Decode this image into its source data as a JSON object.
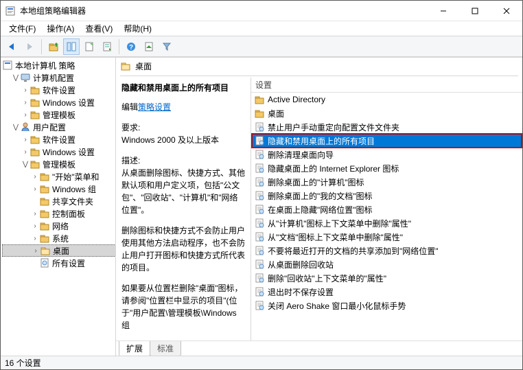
{
  "title": "本地组策略编辑器",
  "menus": {
    "file": "文件(F)",
    "action": "操作(A)",
    "view": "查看(V)",
    "help": "帮助(H)"
  },
  "toolbar": {
    "back": "后退",
    "forward": "前进",
    "up": "上一级",
    "properties": "属性",
    "refresh": "刷新",
    "export": "导出列表",
    "help": "帮助",
    "show": "显示/隐藏",
    "filter": "筛选"
  },
  "tree": {
    "root": "本地计算机 策略",
    "computer": "计算机配置",
    "user": "用户配置",
    "software": "软件设置",
    "windows": "Windows 设置",
    "admin": "管理模板",
    "start_menu": "\"开始\"菜单和",
    "windows_components": "Windows 组",
    "shared_folders": "共享文件夹",
    "control_panel": "控制面板",
    "network": "网络",
    "system": "系统",
    "desktop": "桌面",
    "all_settings": "所有设置"
  },
  "right": {
    "header": "桌面",
    "column": "设置",
    "tabs": {
      "extended": "扩展",
      "standard": "标准"
    }
  },
  "detail": {
    "title": "隐藏和禁用桌面上的所有项目",
    "edit_prefix": "编辑",
    "edit_link": "策略设置",
    "req_label": "要求:",
    "req_text": "Windows 2000 及以上版本",
    "desc_label": "描述:",
    "desc_p1": "从桌面删除图标、快捷方式、其他默认项和用户定义项，包括\"公文包\"、\"回收站\"、\"计算机\"和\"网络位置\"。",
    "desc_p2": "删除图标和快捷方式不会防止用户使用其他方法启动程序，也不会防止用户打开图标和快捷方式所代表的项目。",
    "desc_p3": "如果要从位置栏删除\"桌面\"图标，请参阅\"位置栏中显示的项目\"(位于\"用户配置\\管理模板\\Windows 组"
  },
  "list": [
    {
      "type": "folder",
      "label": "Active Directory"
    },
    {
      "type": "folder",
      "label": "桌面"
    },
    {
      "type": "setting",
      "label": "禁止用户手动重定向配置文件文件夹"
    },
    {
      "type": "setting",
      "label": "隐藏和禁用桌面上的所有项目",
      "selected": true,
      "highlight": true
    },
    {
      "type": "setting",
      "label": "删除清理桌面向导"
    },
    {
      "type": "setting",
      "label": "隐藏桌面上的 Internet Explorer 图标"
    },
    {
      "type": "setting",
      "label": "删除桌面上的\"计算机\"图标"
    },
    {
      "type": "setting",
      "label": "删除桌面上的\"我的文档\"图标"
    },
    {
      "type": "setting",
      "label": "在桌面上隐藏\"网络位置\"图标"
    },
    {
      "type": "setting",
      "label": "从\"计算机\"图标上下文菜单中删除\"属性\""
    },
    {
      "type": "setting",
      "label": "从\"文档\"图标上下文菜单中删除\"属性\""
    },
    {
      "type": "setting",
      "label": "不要将最近打开的文档的共享添加到\"网络位置\""
    },
    {
      "type": "setting",
      "label": "从桌面删除回收站"
    },
    {
      "type": "setting",
      "label": "删除\"回收站\"上下文菜单的\"属性\""
    },
    {
      "type": "setting",
      "label": "退出时不保存设置"
    },
    {
      "type": "setting",
      "label": "关闭 Aero Shake 窗口最小化鼠标手势"
    }
  ],
  "status": "16 个设置"
}
